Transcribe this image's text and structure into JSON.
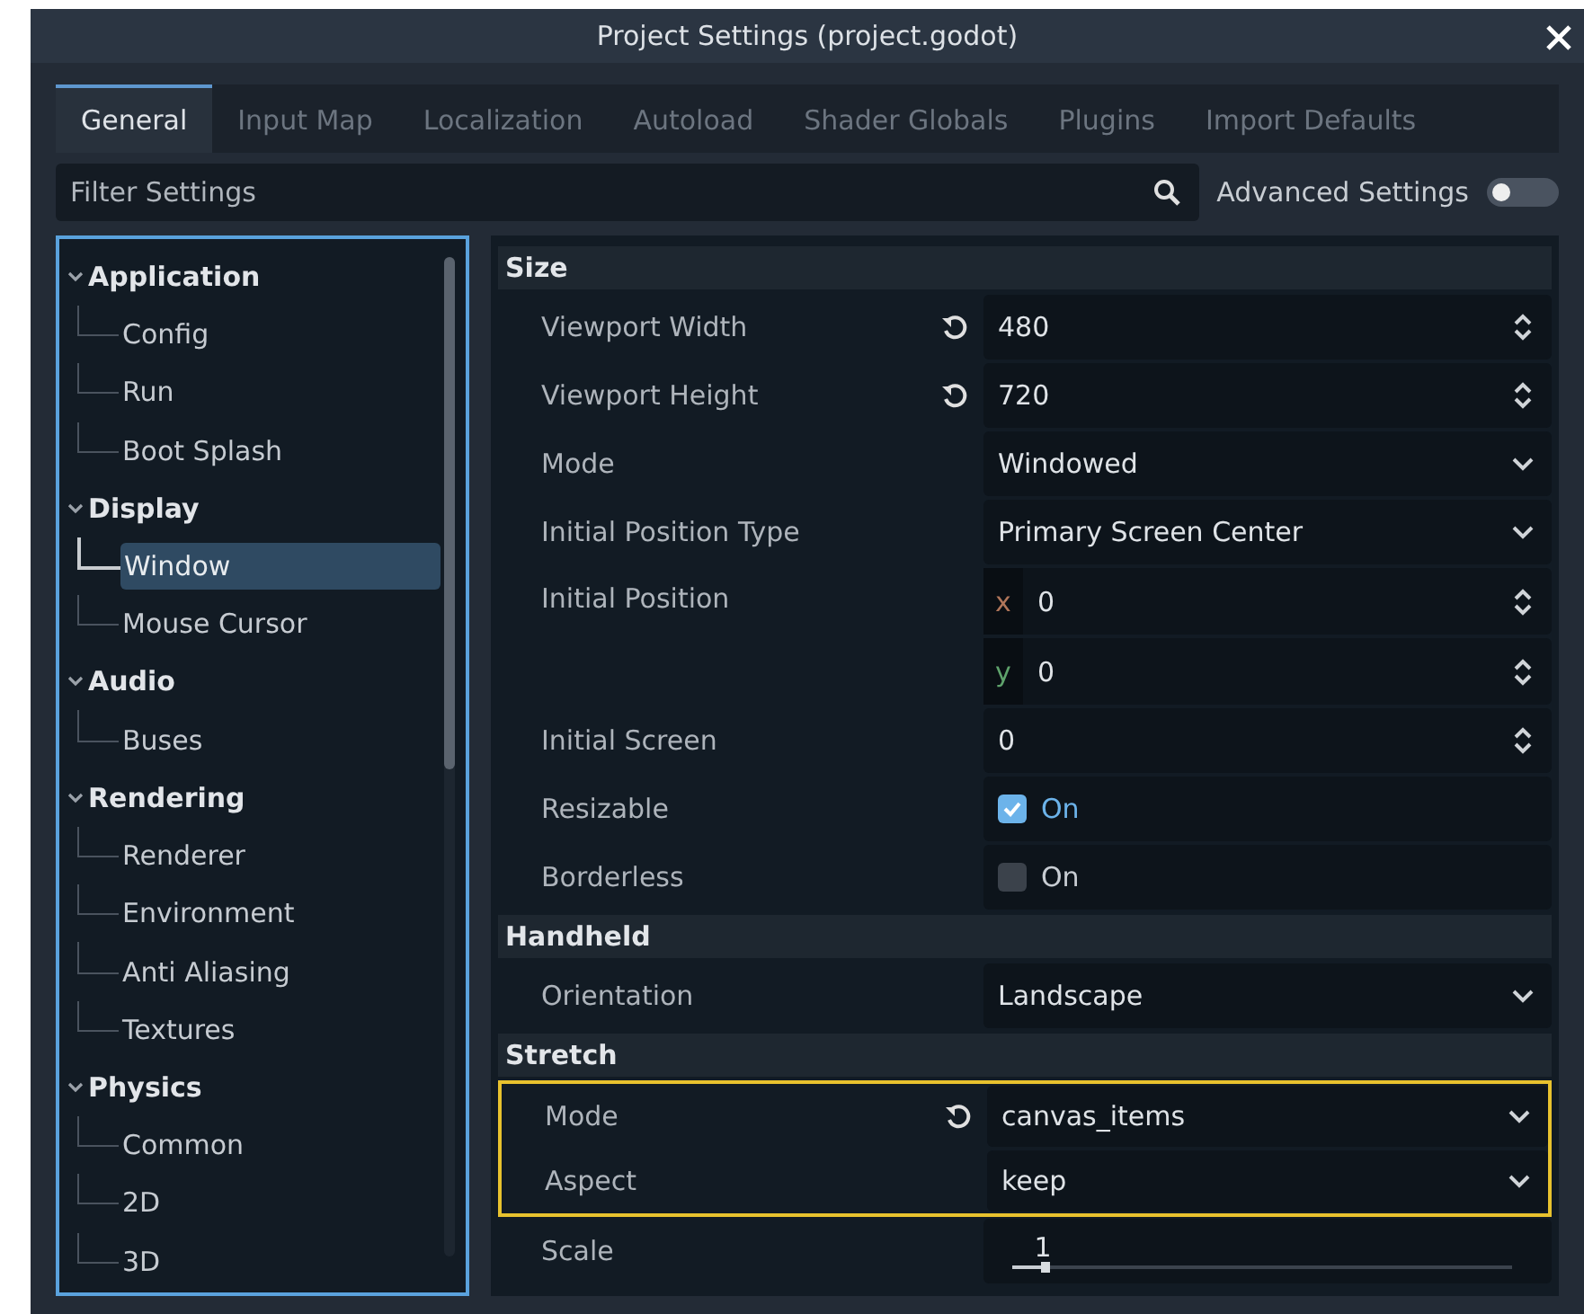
{
  "window": {
    "title": "Project Settings (project.godot)"
  },
  "tabs": [
    {
      "label": "General",
      "selected": true
    },
    {
      "label": "Input Map",
      "selected": false
    },
    {
      "label": "Localization",
      "selected": false
    },
    {
      "label": "Autoload",
      "selected": false
    },
    {
      "label": "Shader Globals",
      "selected": false
    },
    {
      "label": "Plugins",
      "selected": false
    },
    {
      "label": "Import Defaults",
      "selected": false
    }
  ],
  "filter": {
    "placeholder": "Filter Settings"
  },
  "advanced_settings": {
    "label": "Advanced Settings",
    "on": false
  },
  "sidebar": {
    "items": [
      {
        "label": "Application",
        "expanded": true,
        "children": [
          {
            "label": "Config",
            "selected": false
          },
          {
            "label": "Run",
            "selected": false
          },
          {
            "label": "Boot Splash",
            "selected": false
          }
        ]
      },
      {
        "label": "Display",
        "expanded": true,
        "children": [
          {
            "label": "Window",
            "selected": true
          },
          {
            "label": "Mouse Cursor",
            "selected": false
          }
        ]
      },
      {
        "label": "Audio",
        "expanded": true,
        "children": [
          {
            "label": "Buses",
            "selected": false
          }
        ]
      },
      {
        "label": "Rendering",
        "expanded": true,
        "children": [
          {
            "label": "Renderer",
            "selected": false
          },
          {
            "label": "Environment",
            "selected": false
          },
          {
            "label": "Anti Aliasing",
            "selected": false
          },
          {
            "label": "Textures",
            "selected": false
          }
        ]
      },
      {
        "label": "Physics",
        "expanded": true,
        "children": [
          {
            "label": "Common",
            "selected": false
          },
          {
            "label": "2D",
            "selected": false
          },
          {
            "label": "3D",
            "selected": false
          }
        ]
      }
    ]
  },
  "sections": [
    {
      "title": "Size",
      "properties": [
        {
          "label": "Viewport Width",
          "kind": "spin",
          "value": "480",
          "revert": true,
          "highlighted": false
        },
        {
          "label": "Viewport Height",
          "kind": "spin",
          "value": "720",
          "revert": true,
          "highlighted": false
        },
        {
          "label": "Mode",
          "kind": "select",
          "value": "Windowed",
          "revert": false,
          "highlighted": false
        },
        {
          "label": "Initial Position Type",
          "kind": "select",
          "value": "Primary Screen Center",
          "revert": false,
          "highlighted": false
        },
        {
          "label": "Initial Position",
          "kind": "vector",
          "revert": false,
          "highlighted": false,
          "components": [
            {
              "axis": "x",
              "value": "0",
              "color": "#b0765a"
            },
            {
              "axis": "y",
              "value": "0",
              "color": "#5fa36c"
            }
          ]
        },
        {
          "label": "Initial Screen",
          "kind": "spin",
          "value": "0",
          "revert": false,
          "highlighted": false
        },
        {
          "label": "Resizable",
          "kind": "check",
          "value": "On",
          "checked": true,
          "revert": false,
          "highlighted": false
        },
        {
          "label": "Borderless",
          "kind": "check",
          "value": "On",
          "checked": false,
          "revert": false,
          "highlighted": false
        }
      ]
    },
    {
      "title": "Handheld",
      "properties": [
        {
          "label": "Orientation",
          "kind": "select",
          "value": "Landscape",
          "revert": false,
          "highlighted": false
        }
      ]
    },
    {
      "title": "Stretch",
      "properties": [
        {
          "label": "Mode",
          "kind": "select",
          "value": "canvas_items",
          "revert": true,
          "highlighted": true
        },
        {
          "label": "Aspect",
          "kind": "select",
          "value": "keep",
          "revert": false,
          "highlighted": true
        },
        {
          "label": "Scale",
          "kind": "slider",
          "value": "1",
          "level": 0.07,
          "revert": false,
          "highlighted": false
        }
      ]
    }
  ]
}
